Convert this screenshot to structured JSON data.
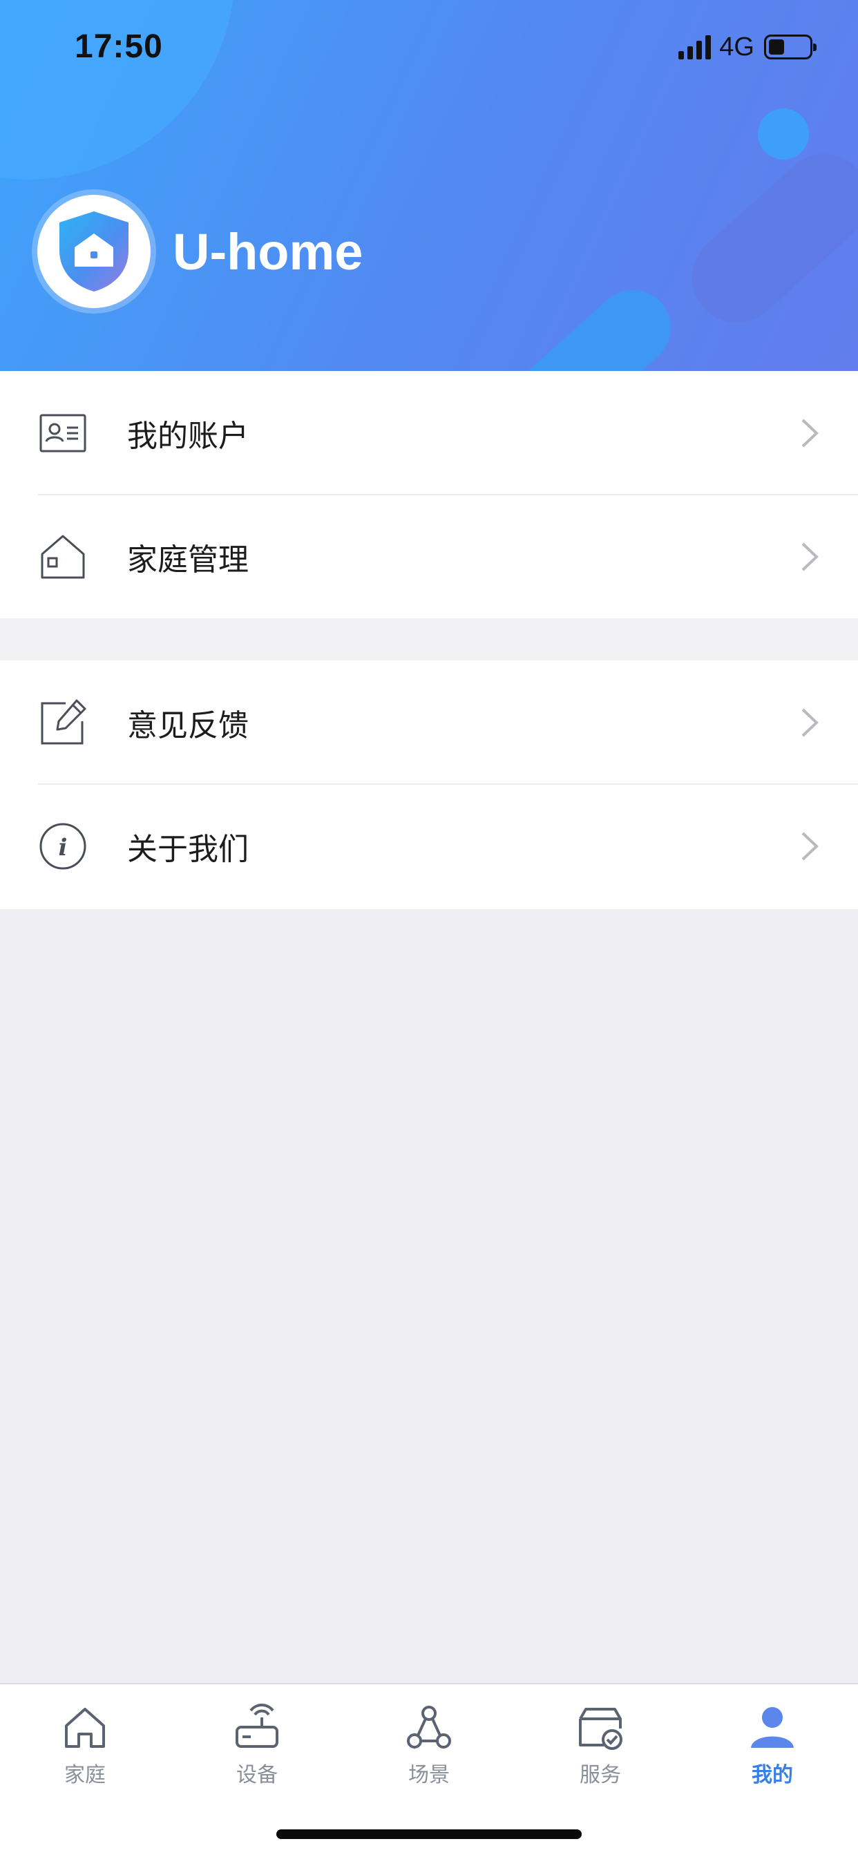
{
  "status_bar": {
    "time": "17:50",
    "network": "4G",
    "battery_level": 0.35
  },
  "header": {
    "app_name": "U-home"
  },
  "menu": {
    "group1": [
      {
        "label": "我的账户",
        "icon": "contact-card-icon"
      },
      {
        "label": "家庭管理",
        "icon": "house-icon"
      }
    ],
    "group2": [
      {
        "label": "意见反馈",
        "icon": "edit-note-icon"
      },
      {
        "label": "关于我们",
        "icon": "info-circle-icon"
      }
    ]
  },
  "tabbar": {
    "tabs": [
      {
        "label": "家庭",
        "icon": "home-tab-icon"
      },
      {
        "label": "设备",
        "icon": "router-device-icon"
      },
      {
        "label": "场景",
        "icon": "scene-nodes-icon"
      },
      {
        "label": "服务",
        "icon": "service-box-icon"
      },
      {
        "label": "我的",
        "icon": "person-icon"
      }
    ],
    "active_index": 4
  },
  "colors": {
    "header_gradient_start": "#3fa4fb",
    "header_gradient_end": "#627ded",
    "accent": "#3a7fe8",
    "page_background": "#eeeef3"
  }
}
